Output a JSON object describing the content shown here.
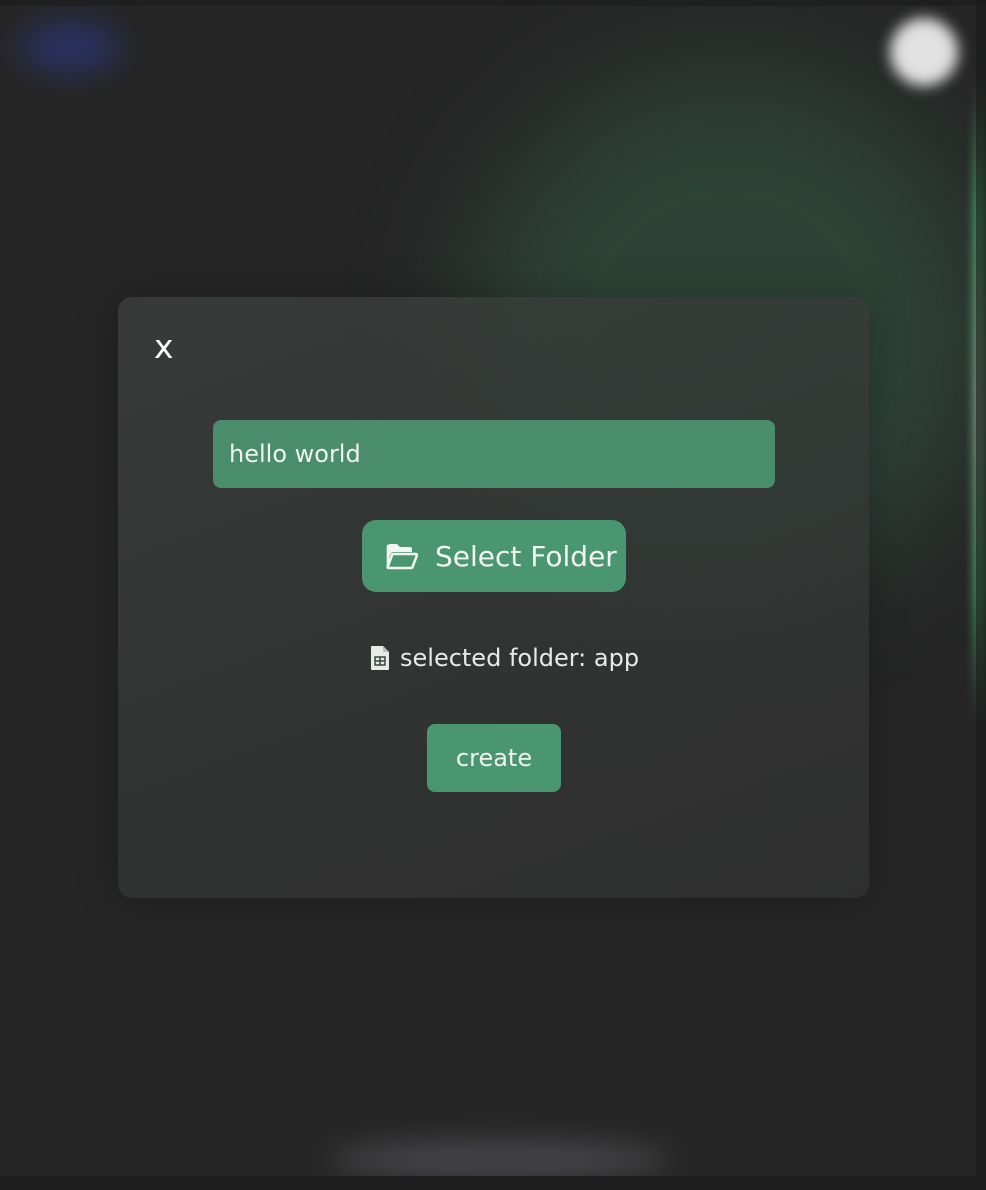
{
  "modal": {
    "close_label": "x",
    "name_input": {
      "value": "hello world",
      "placeholder": ""
    },
    "select_folder": {
      "label": "Select Folder",
      "icon": "folder-open-icon"
    },
    "selected_folder": {
      "text": "selected folder: app",
      "icon": "file-spreadsheet-icon"
    },
    "create_label": "create"
  },
  "colors": {
    "accent": "#4a9670",
    "input_bg": "#4a8d6c",
    "backdrop": "#262626"
  }
}
